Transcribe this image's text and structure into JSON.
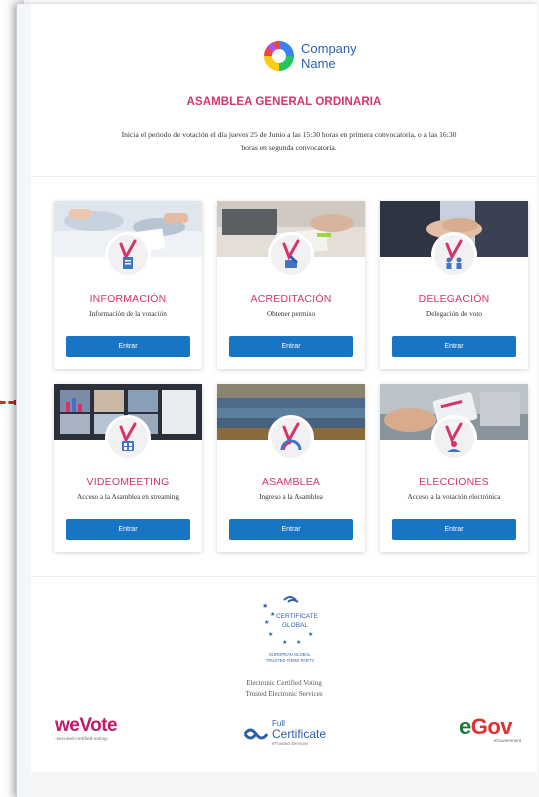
{
  "brand": {
    "line1": "Company",
    "line2": "Name"
  },
  "header": {
    "title": "ASAMBLEA GENERAL ORDINARIA",
    "intro": "Inicia el periodo de votación el día jueves 25 de Junio a las 15:30 horas en primera convocatoria, o a las 16:30 horas en segunda convocatoria."
  },
  "cards": [
    {
      "title": "INFORMACIÓN",
      "subtitle": "Información de la votación",
      "button": "Entrar",
      "icon": "document-icon"
    },
    {
      "title": "ACREDITACIÓN",
      "subtitle": "Obtener permiso",
      "button": "Entrar",
      "icon": "pen-icon"
    },
    {
      "title": "DELEGACIÓN",
      "subtitle": "Delegación de voto",
      "button": "Entrar",
      "icon": "people-icon"
    },
    {
      "title": "VIDEOMEETING",
      "subtitle": "Acceso a la Asamblea en streaming",
      "button": "Entrar",
      "icon": "video-icon"
    },
    {
      "title": "ASAMBLEA",
      "subtitle": "Ingreso a la Asamblea",
      "button": "Entrar",
      "icon": "speedometer-icon"
    },
    {
      "title": "ELECCIONES",
      "subtitle": "Acceso a la votación electrónica",
      "button": "Entrar",
      "icon": "vote-hand-icon"
    }
  ],
  "footer": {
    "certificate": {
      "line1": "CERTIFICATE",
      "line2": "GLOBAL",
      "line3": "EUROPEAN GLOBAL",
      "line4": "TRUSTED THIRD PARTY"
    },
    "caption1": "Electronic Certified Voting",
    "caption2": "Trusted Electronic Services",
    "wevote": {
      "word": "weVote",
      "tagline": "-secured-certified-voting-"
    },
    "fullcert": {
      "line1": "Full",
      "line2": "Certificate",
      "line3": "eTrusted Services"
    },
    "egov": {
      "e": "e",
      "gov": "Gov",
      "tagline": "eGovernment"
    }
  },
  "colors": {
    "accent": "#d6336c",
    "button": "#1874c4",
    "brand_blue": "#2e5fa8"
  }
}
